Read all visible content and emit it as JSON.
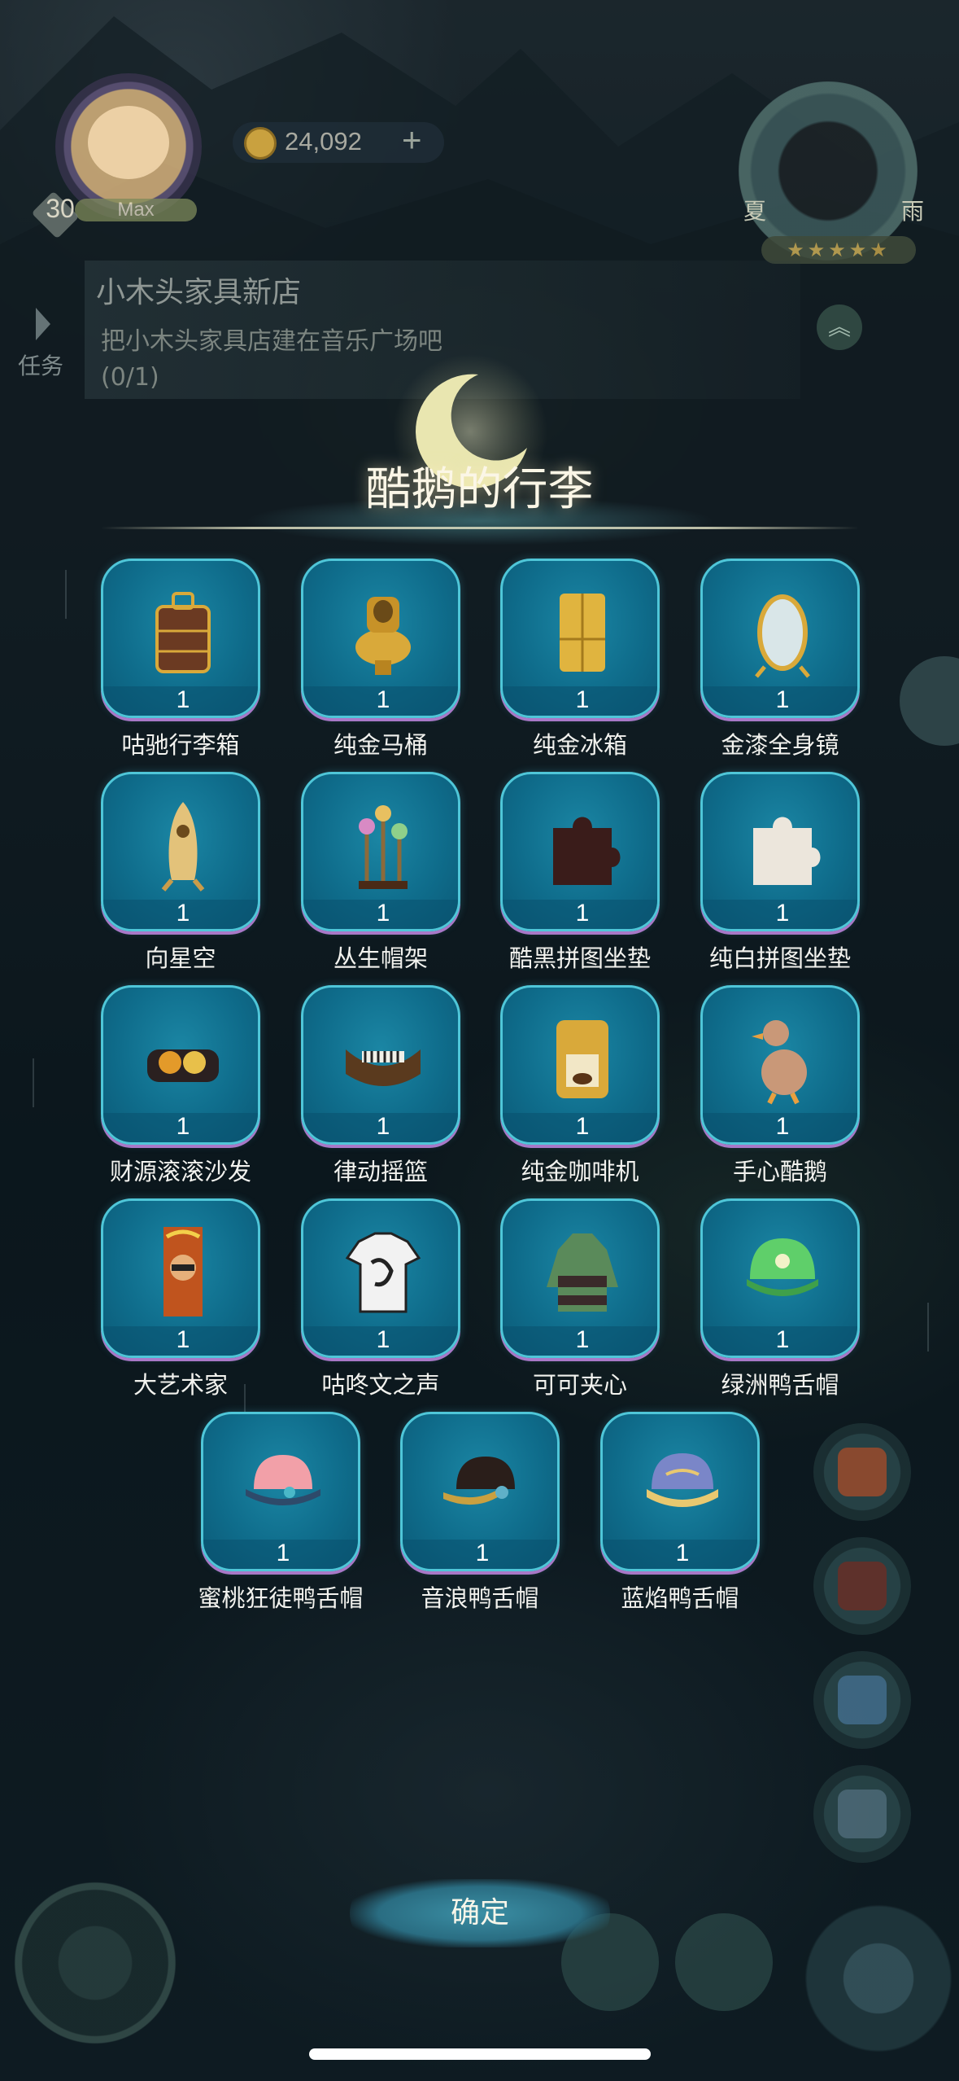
{
  "hud": {
    "level": "30",
    "level_status": "Max",
    "coins": "24,092",
    "add_coins": "+",
    "season_left": "夏",
    "season_right": "雨",
    "stars": "★★★★★"
  },
  "quest": {
    "tab_label": "任务",
    "title": "小木头家具新店",
    "description": "把小木头家具店建在音乐广场吧",
    "progress": "(0/1)"
  },
  "modal": {
    "title": "酷鹅的行李",
    "confirm_label": "确定"
  },
  "items": [
    {
      "name": "咕驰行李箱",
      "qty": "1",
      "icon": "luggage-icon"
    },
    {
      "name": "纯金马桶",
      "qty": "1",
      "icon": "gold-toilet-icon"
    },
    {
      "name": "纯金冰箱",
      "qty": "1",
      "icon": "gold-fridge-icon"
    },
    {
      "name": "金漆全身镜",
      "qty": "1",
      "icon": "gold-mirror-icon"
    },
    {
      "name": "向星空",
      "qty": "1",
      "icon": "rocket-icon"
    },
    {
      "name": "丛生帽架",
      "qty": "1",
      "icon": "mushroom-hat-rack-icon"
    },
    {
      "name": "酷黑拼图坐垫",
      "qty": "1",
      "icon": "black-puzzle-cushion-icon"
    },
    {
      "name": "纯白拼图坐垫",
      "qty": "1",
      "icon": "white-puzzle-cushion-icon"
    },
    {
      "name": "财源滚滚沙发",
      "qty": "1",
      "icon": "coin-sofa-icon"
    },
    {
      "name": "律动摇篮",
      "qty": "1",
      "icon": "rhythm-cradle-icon"
    },
    {
      "name": "纯金咖啡机",
      "qty": "1",
      "icon": "gold-coffee-machine-icon"
    },
    {
      "name": "手心酷鹅",
      "qty": "1",
      "icon": "goose-figure-icon"
    },
    {
      "name": "大艺术家",
      "qty": "1",
      "icon": "artist-poster-icon"
    },
    {
      "name": "咕咚文之声",
      "qty": "1",
      "icon": "tshirt-icon"
    },
    {
      "name": "可可夹心",
      "qty": "1",
      "icon": "hoodie-icon"
    },
    {
      "name": "绿洲鸭舌帽",
      "qty": "1",
      "icon": "green-cap-icon"
    },
    {
      "name": "蜜桃狂徒鸭舌帽",
      "qty": "1",
      "icon": "pink-cap-icon"
    },
    {
      "name": "音浪鸭舌帽",
      "qty": "1",
      "icon": "black-cap-icon"
    },
    {
      "name": "蓝焰鸭舌帽",
      "qty": "1",
      "icon": "blue-cap-icon"
    }
  ],
  "colors": {
    "card_fill": "#0f6d8c",
    "card_border": "#4fc6d8",
    "card_shadow": "#a878c7",
    "gold": "#d9a93a"
  }
}
